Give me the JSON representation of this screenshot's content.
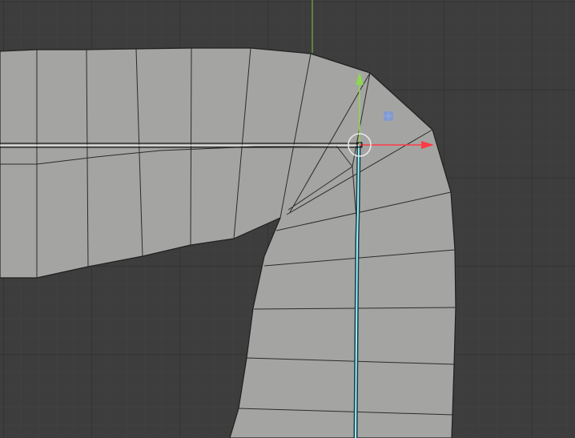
{
  "viewport": {
    "background_color": "#3d3d3d",
    "grid_minor_color": "#444444",
    "grid_major_color": "#2f2f2f",
    "y_axis_line_color": "#6d9a3a",
    "mesh_fill_color": "#a4a5a3",
    "mesh_edge_color": "#2a2a2a",
    "selected_edge_color": "#9af0ff",
    "selected_edge_shadow": "#1c3c42"
  },
  "gizmo": {
    "type": "move-gizmo",
    "x_axis_color": "#ff3b47",
    "y_axis_color": "#8fd651",
    "pivot_circle_color": "#e8e8e8",
    "plane_handle_color": "#6f94e8",
    "icons": [
      "x-axis-arrow-icon",
      "y-axis-arrow-icon",
      "pivot-circle-icon",
      "xy-plane-handle-icon"
    ]
  }
}
